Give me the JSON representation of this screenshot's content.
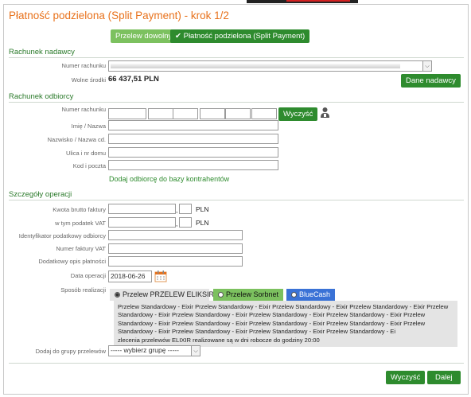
{
  "title": "Płatność podzielona (Split Payment) - krok 1/2",
  "top_tabs": {
    "free_transfer": "Przelew dowolny",
    "split_payment": "Płatność podzielona (Split Payment)",
    "check": "✔"
  },
  "sender": {
    "section": "Rachunek nadawcy",
    "account_label": "Numer rachunku",
    "funds_label": "Wolne środki",
    "funds_value": "66 437,51 PLN",
    "sender_data_button": "Dane nadawcy"
  },
  "recipient": {
    "section": "Rachunek odbiorcy",
    "account_label": "Numer rachunku",
    "clear_button": "Wyczyść",
    "name_label": "Imię / Nazwa",
    "name_cont_label": "Nazwisko / Nazwa cd.",
    "street_label": "Ulica i nr domu",
    "postal_label": "Kod i poczta",
    "add_link": "Dodaj odbiorcę do bazy kontrahentów"
  },
  "details": {
    "section": "Szczegóły operacji",
    "gross_label": "Kwota brutto faktury",
    "vat_label": "w tym podatek VAT",
    "currency": "PLN",
    "comma": ",",
    "tax_id_label": "Identyfikator podatkowy odbiorcy",
    "invoice_label": "Numer faktury VAT",
    "extra_desc_label": "Dodatkowy opis płatności",
    "date_label": "Data operacji",
    "date_value": "2018-06-26",
    "method_label": "Sposób realizacji",
    "methods": [
      "Przelew PRZELEW ELIKSIR",
      "Przelew Sorbnet",
      "BlueCash"
    ],
    "method_description": "Przelew Standardowy - Eixir Przelew Standardowy - Eixir Przelew Standardowy - Eixir Przelew Standardowy - Eixir Przelew Standardowy - Eixir Przelew Standardowy - Eixir Przelew Standardowy - Eixir Przelew Standardowy - Eixir Przelew Standardowy - Eixir Przelew Standardowy - Eixir Przelew Standardowy - Eixir Przelew Standardowy - Eixir Przelew Standardowy - Eixir Przelew Standardowy - Eixir Przelew Standardowy - Eixir Przelew Standardowy - Ei",
    "method_note": "zlecenia przelewów ELIXIR realizowane są w dni robocze do godziny 20:00",
    "group_label": "Dodaj do grupy przelewów",
    "group_value": "----- wybierz grupę -----"
  },
  "footer": {
    "clear": "Wyczyść",
    "next": "Dalej"
  },
  "colors": {
    "accent": "#e8721c",
    "green": "#2e8b2e",
    "green_light": "#7cc15f",
    "bluecash": "#3a72d6"
  },
  "icons": [
    "contacts-icon",
    "calendar-icon",
    "chevron-down-icon",
    "check-icon"
  ]
}
